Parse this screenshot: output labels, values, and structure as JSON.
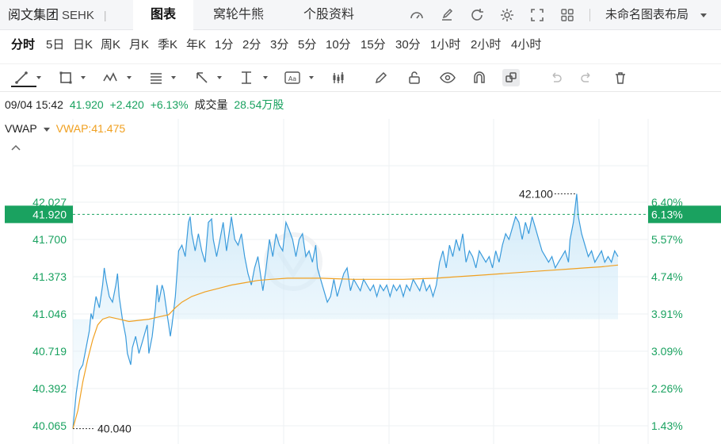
{
  "header": {
    "stock_name": "阅文集团",
    "exchange": "SEHK",
    "separator": "|",
    "tabs": [
      {
        "label": "图表",
        "active": true
      },
      {
        "label": "窝轮牛熊",
        "active": false
      },
      {
        "label": "个股资料",
        "active": false
      }
    ],
    "icons": [
      "gauge-icon",
      "edit-icon",
      "refresh-icon",
      "settings-icon",
      "fullscreen-icon",
      "grid-icon"
    ],
    "layout_name": "未命名图表布局"
  },
  "periods": {
    "items": [
      "分时",
      "5日",
      "日K",
      "周K",
      "月K",
      "季K",
      "年K",
      "1分",
      "2分",
      "3分",
      "5分",
      "10分",
      "15分",
      "30分",
      "1小时",
      "2小时",
      "4小时"
    ],
    "active": "分时"
  },
  "tools": [
    "line-tool-icon",
    "rect-tool-icon",
    "wave-tool-icon",
    "fib-tool-icon",
    "arrow-tool-icon",
    "measure-tool-icon",
    "text-tool-icon",
    "candles-icon",
    "pen-icon",
    "lock-icon",
    "eye-icon",
    "magnet-icon",
    "link-icon",
    "undo-icon",
    "redo-icon",
    "trash-icon"
  ],
  "info": {
    "time": "09/04 15:42",
    "price": "41.920",
    "change": "+2.420",
    "change_pct": "+6.13%",
    "volume_label": "成交量",
    "volume": "28.54万股"
  },
  "indicator": {
    "name": "VWAP",
    "value_text": "VWAP:41.475"
  },
  "colors": {
    "green": "#1aa260",
    "price_line": "#3a9bdc",
    "vwap_line": "#f0a020",
    "current_badge": "#1aa260"
  },
  "chart_data": {
    "type": "line",
    "ylim": [
      39.95,
      42.2
    ],
    "y_ticks": [
      {
        "value": 42.027,
        "label": "42.027",
        "pct": "6.40%"
      },
      {
        "value": 41.7,
        "label": "41.700",
        "pct": "5.57%"
      },
      {
        "value": 41.373,
        "label": "41.373",
        "pct": "4.74%"
      },
      {
        "value": 41.046,
        "label": "41.046",
        "pct": "3.91%"
      },
      {
        "value": 40.719,
        "label": "40.719",
        "pct": "3.09%"
      },
      {
        "value": 40.392,
        "label": "40.392",
        "pct": "2.26%"
      },
      {
        "value": 40.065,
        "label": "40.065",
        "pct": "1.43%"
      }
    ],
    "current": {
      "value": 41.92,
      "label": "41.920",
      "pct": "6.13%"
    },
    "high": {
      "value": 42.1,
      "label": "42.100"
    },
    "low": {
      "value": 40.04,
      "label": "40.040"
    },
    "x_count": 330,
    "series": [
      {
        "values": [
          [
            0,
            40.04
          ],
          [
            2,
            40.35
          ],
          [
            4,
            40.55
          ],
          [
            6,
            40.6
          ],
          [
            8,
            40.75
          ],
          [
            10,
            40.9
          ],
          [
            11,
            41.05
          ],
          [
            12,
            41.0
          ],
          [
            14,
            41.2
          ],
          [
            16,
            41.1
          ],
          [
            18,
            41.3
          ],
          [
            19,
            41.45
          ],
          [
            20,
            41.35
          ],
          [
            22,
            41.2
          ],
          [
            24,
            41.15
          ],
          [
            26,
            41.3
          ],
          [
            27,
            41.4
          ],
          [
            28,
            41.2
          ],
          [
            30,
            41.0
          ],
          [
            32,
            40.85
          ],
          [
            33,
            40.7
          ],
          [
            35,
            40.6
          ],
          [
            36,
            40.75
          ],
          [
            38,
            40.85
          ],
          [
            40,
            40.7
          ],
          [
            42,
            40.8
          ],
          [
            44,
            40.9
          ],
          [
            45,
            40.95
          ],
          [
            46,
            40.7
          ],
          [
            48,
            40.85
          ],
          [
            50,
            41.1
          ],
          [
            51,
            41.3
          ],
          [
            52,
            41.15
          ],
          [
            54,
            41.3
          ],
          [
            55,
            41.25
          ],
          [
            57,
            41.05
          ],
          [
            59,
            40.85
          ],
          [
            60,
            40.95
          ],
          [
            62,
            41.2
          ],
          [
            64,
            41.6
          ],
          [
            66,
            41.65
          ],
          [
            68,
            41.55
          ],
          [
            70,
            41.85
          ],
          [
            71,
            41.9
          ],
          [
            72,
            41.75
          ],
          [
            74,
            41.6
          ],
          [
            76,
            41.75
          ],
          [
            78,
            41.6
          ],
          [
            80,
            41.5
          ],
          [
            82,
            41.85
          ],
          [
            84,
            41.88
          ],
          [
            85,
            41.7
          ],
          [
            87,
            41.55
          ],
          [
            89,
            41.7
          ],
          [
            91,
            41.85
          ],
          [
            93,
            41.6
          ],
          [
            95,
            41.8
          ],
          [
            96,
            41.9
          ],
          [
            98,
            41.7
          ],
          [
            100,
            41.65
          ],
          [
            102,
            41.75
          ],
          [
            104,
            41.55
          ],
          [
            106,
            41.4
          ],
          [
            108,
            41.3
          ],
          [
            110,
            41.45
          ],
          [
            112,
            41.55
          ],
          [
            114,
            41.35
          ],
          [
            115,
            41.25
          ],
          [
            117,
            41.45
          ],
          [
            119,
            41.7
          ],
          [
            121,
            41.55
          ],
          [
            123,
            41.75
          ],
          [
            125,
            41.65
          ],
          [
            127,
            41.6
          ],
          [
            129,
            41.85
          ],
          [
            131,
            41.78
          ],
          [
            133,
            41.7
          ],
          [
            135,
            41.55
          ],
          [
            137,
            41.7
          ],
          [
            139,
            41.75
          ],
          [
            141,
            41.55
          ],
          [
            143,
            41.6
          ],
          [
            145,
            41.5
          ],
          [
            147,
            41.65
          ],
          [
            148,
            41.45
          ],
          [
            150,
            41.35
          ],
          [
            152,
            41.25
          ],
          [
            154,
            41.15
          ],
          [
            156,
            41.2
          ],
          [
            158,
            41.35
          ],
          [
            160,
            41.2
          ],
          [
            162,
            41.3
          ],
          [
            164,
            41.4
          ],
          [
            166,
            41.45
          ],
          [
            168,
            41.25
          ],
          [
            170,
            41.35
          ],
          [
            172,
            41.3
          ],
          [
            174,
            41.25
          ],
          [
            176,
            41.35
          ],
          [
            178,
            41.3
          ],
          [
            180,
            41.25
          ],
          [
            182,
            41.3
          ],
          [
            184,
            41.2
          ],
          [
            186,
            41.3
          ],
          [
            188,
            41.25
          ],
          [
            190,
            41.3
          ],
          [
            192,
            41.2
          ],
          [
            194,
            41.3
          ],
          [
            196,
            41.25
          ],
          [
            198,
            41.3
          ],
          [
            200,
            41.2
          ],
          [
            202,
            41.3
          ],
          [
            204,
            41.25
          ],
          [
            206,
            41.35
          ],
          [
            208,
            41.3
          ],
          [
            210,
            41.25
          ],
          [
            212,
            41.35
          ],
          [
            214,
            41.25
          ],
          [
            216,
            41.3
          ],
          [
            218,
            41.2
          ],
          [
            220,
            41.3
          ],
          [
            222,
            41.5
          ],
          [
            224,
            41.6
          ],
          [
            226,
            41.45
          ],
          [
            228,
            41.65
          ],
          [
            230,
            41.55
          ],
          [
            232,
            41.7
          ],
          [
            234,
            41.6
          ],
          [
            236,
            41.75
          ],
          [
            238,
            41.5
          ],
          [
            240,
            41.6
          ],
          [
            242,
            41.55
          ],
          [
            244,
            41.45
          ],
          [
            246,
            41.6
          ],
          [
            248,
            41.55
          ],
          [
            250,
            41.5
          ],
          [
            252,
            41.55
          ],
          [
            254,
            41.45
          ],
          [
            256,
            41.6
          ],
          [
            258,
            41.5
          ],
          [
            260,
            41.65
          ],
          [
            262,
            41.75
          ],
          [
            264,
            41.7
          ],
          [
            266,
            41.8
          ],
          [
            268,
            41.9
          ],
          [
            270,
            41.85
          ],
          [
            272,
            41.7
          ],
          [
            274,
            41.85
          ],
          [
            276,
            41.75
          ],
          [
            278,
            41.9
          ],
          [
            280,
            41.8
          ],
          [
            282,
            41.7
          ],
          [
            284,
            41.6
          ],
          [
            286,
            41.55
          ],
          [
            288,
            41.5
          ],
          [
            290,
            41.55
          ],
          [
            292,
            41.45
          ],
          [
            294,
            41.5
          ],
          [
            296,
            41.55
          ],
          [
            298,
            41.6
          ],
          [
            300,
            41.5
          ],
          [
            301,
            41.7
          ],
          [
            303,
            41.85
          ],
          [
            305,
            42.1
          ],
          [
            306,
            41.9
          ],
          [
            308,
            41.75
          ],
          [
            310,
            41.65
          ],
          [
            312,
            41.55
          ],
          [
            314,
            41.6
          ],
          [
            316,
            41.5
          ],
          [
            318,
            41.55
          ],
          [
            320,
            41.6
          ],
          [
            322,
            41.5
          ],
          [
            324,
            41.55
          ],
          [
            326,
            41.5
          ],
          [
            328,
            41.6
          ],
          [
            330,
            41.55
          ]
        ]
      },
      {
        "name": "VWAP",
        "values": [
          [
            0,
            40.04
          ],
          [
            3,
            40.2
          ],
          [
            6,
            40.45
          ],
          [
            9,
            40.65
          ],
          [
            12,
            40.82
          ],
          [
            15,
            40.95
          ],
          [
            18,
            41.0
          ],
          [
            22,
            41.02
          ],
          [
            28,
            41.0
          ],
          [
            34,
            40.98
          ],
          [
            40,
            40.99
          ],
          [
            46,
            41.0
          ],
          [
            52,
            41.02
          ],
          [
            58,
            41.04
          ],
          [
            62,
            41.1
          ],
          [
            66,
            41.15
          ],
          [
            72,
            41.2
          ],
          [
            80,
            41.24
          ],
          [
            88,
            41.27
          ],
          [
            96,
            41.3
          ],
          [
            104,
            41.32
          ],
          [
            112,
            41.34
          ],
          [
            120,
            41.35
          ],
          [
            130,
            41.36
          ],
          [
            140,
            41.36
          ],
          [
            150,
            41.36
          ],
          [
            160,
            41.355
          ],
          [
            170,
            41.35
          ],
          [
            180,
            41.35
          ],
          [
            190,
            41.35
          ],
          [
            200,
            41.35
          ],
          [
            210,
            41.355
          ],
          [
            220,
            41.36
          ],
          [
            230,
            41.37
          ],
          [
            240,
            41.38
          ],
          [
            250,
            41.39
          ],
          [
            260,
            41.4
          ],
          [
            270,
            41.41
          ],
          [
            280,
            41.42
          ],
          [
            290,
            41.43
          ],
          [
            300,
            41.44
          ],
          [
            310,
            41.45
          ],
          [
            320,
            41.46
          ],
          [
            330,
            41.475
          ]
        ]
      }
    ]
  }
}
